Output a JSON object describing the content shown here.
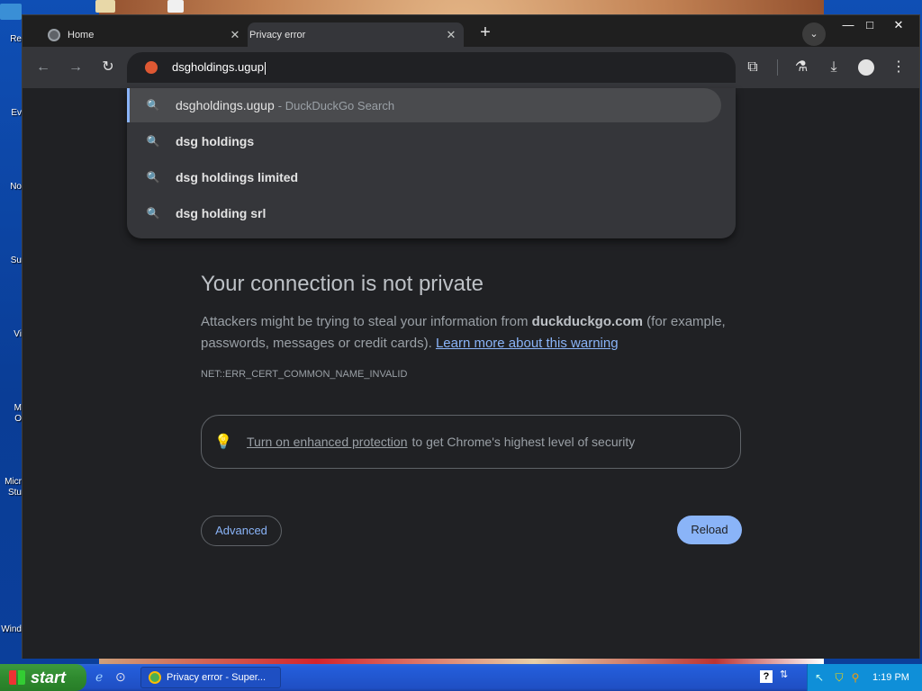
{
  "desktop": {
    "labels": [
      "Re",
      "Ev",
      "No",
      "Su",
      "Vi",
      "M",
      "O",
      "Micr",
      "Stu",
      "Wind"
    ]
  },
  "tabs": [
    {
      "label": "Home"
    },
    {
      "label": "Privacy error"
    }
  ],
  "window_controls": {
    "minimize": "—",
    "maximize": "□",
    "close": "✕"
  },
  "toolbar": {
    "back": "←",
    "forward": "→",
    "reload": "↻",
    "omnibox_value": "dsgholdings.ugup",
    "extensions": "⧉",
    "labs": "⚗",
    "downloads": "⤓",
    "menu": "⋮"
  },
  "suggestions": [
    {
      "text": "dsgholdings.ugup",
      "suffix": "- DuckDuckGo Search",
      "icon": "search-icon"
    },
    {
      "text": "dsg holdings",
      "icon": "search-icon"
    },
    {
      "text": "dsg holdings limited",
      "icon": "search-icon"
    },
    {
      "text": "dsg holding srl",
      "icon": "search-icon"
    }
  ],
  "page": {
    "title": "Your connection is not private",
    "desc_before": "Attackers might be trying to steal your information from ",
    "desc_domain": "duckduckgo.com",
    "desc_after": " (for example, passwords, messages or credit cards). ",
    "learn_more": "Learn more about this warning",
    "error_code": "NET::ERR_CERT_COMMON_NAME_INVALID",
    "enhanced_link": "Turn on enhanced protection",
    "enhanced_rest": "to get Chrome's highest level of security",
    "advanced_label": "Advanced",
    "reload_label": "Reload"
  },
  "taskbar": {
    "start_label": "start",
    "task_item": "Privacy error - Super...",
    "help": "?",
    "clock": "1:19 PM"
  },
  "colors": {
    "page_bg": "#202124",
    "accent": "#8ab4f8",
    "taskbar": "#245edb",
    "start_green": "#2f8a2f"
  }
}
